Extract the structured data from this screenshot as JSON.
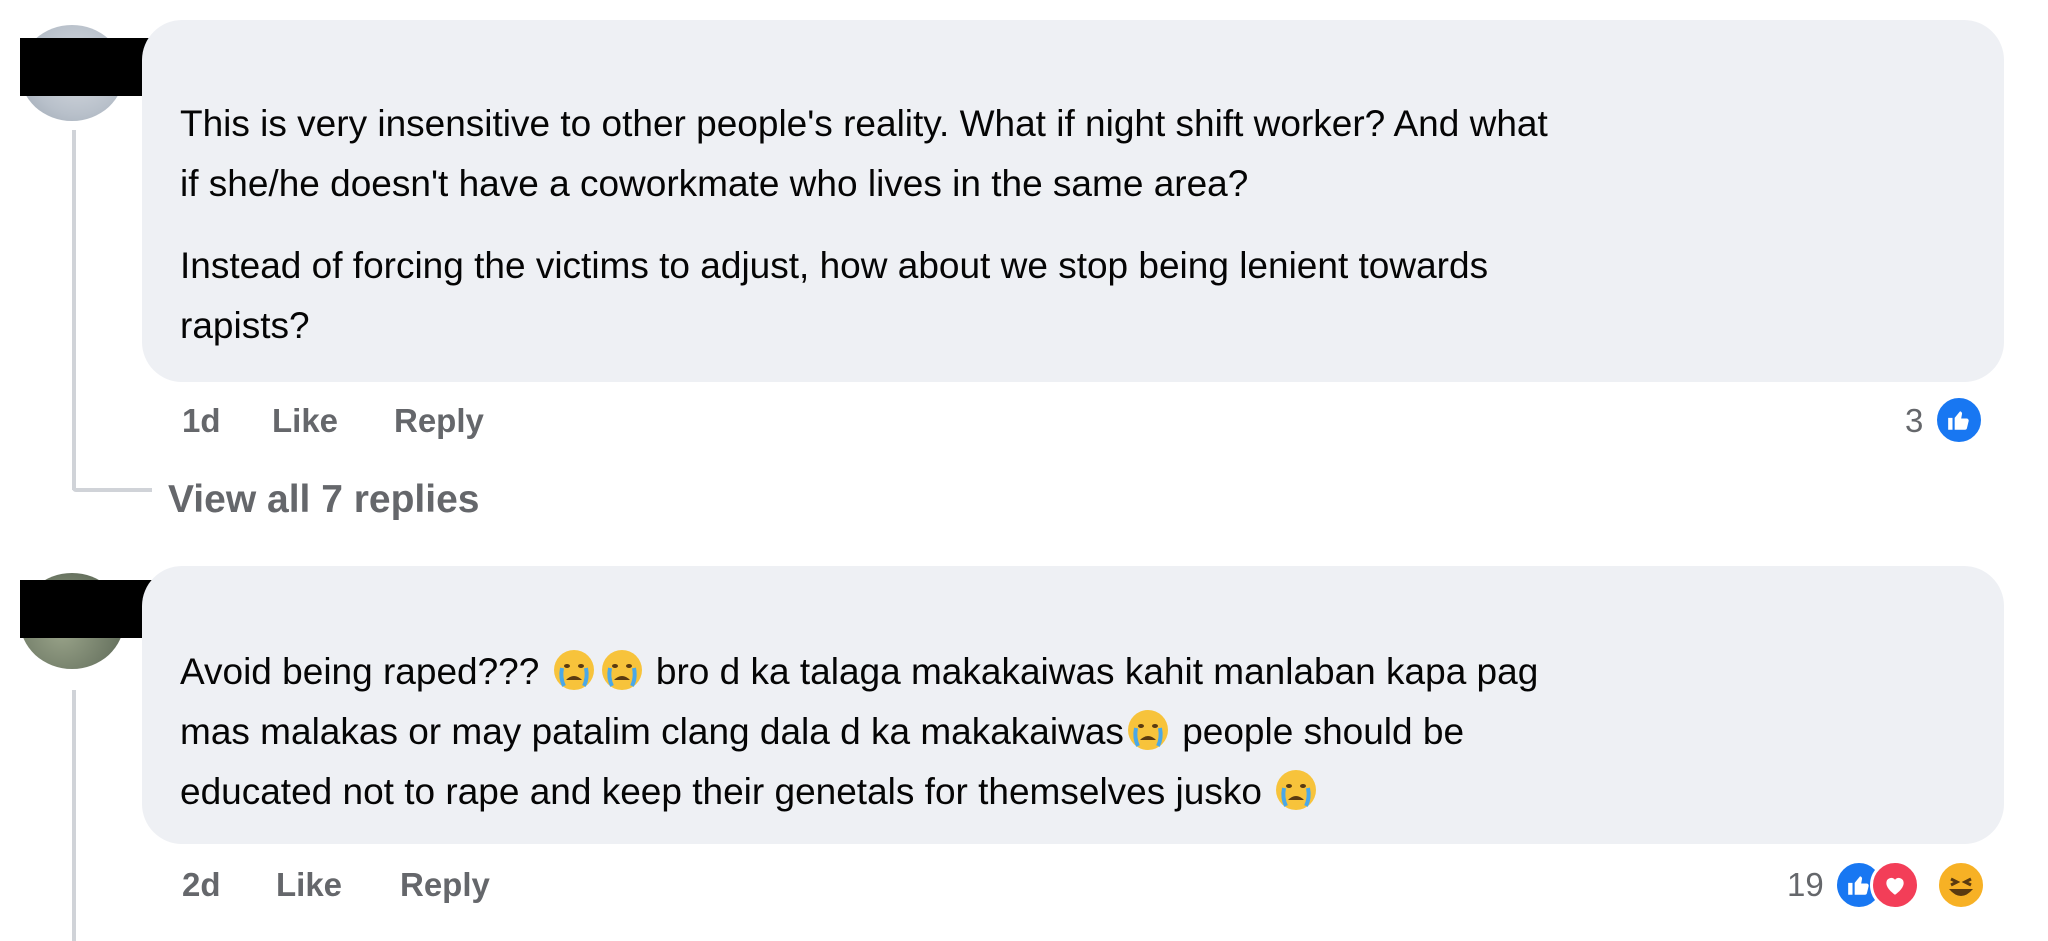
{
  "comments": [
    {
      "paragraphs": [
        "This is very insensitive to other people's reality. What if night shift worker? And what",
        "if she/he doesn't have a coworkmate who lives in the same area?",
        "Instead of forcing the victims to adjust, how about we stop being lenient towards",
        "rapists?"
      ],
      "time": "1d",
      "like_label": "Like",
      "reply_label": "Reply",
      "reaction_count": "3",
      "reactions": [
        "like-icon"
      ],
      "view_replies": "View all 7 replies"
    },
    {
      "line1_a": "Avoid being raped???",
      "line1_b": "bro d ka talaga makakaiwas kahit manlaban kapa pag",
      "line2_a": "mas malakas or may patalim clang dala d ka makakaiwas",
      "line2_b": "people should be",
      "line3_a": "educated not to rape and keep their genetals for themselves jusko",
      "emoji": "crying-face-emoji",
      "time": "2d",
      "like_label": "Like",
      "reply_label": "Reply",
      "reaction_count": "19",
      "reactions": [
        "like-icon",
        "love-icon",
        "haha-icon"
      ]
    }
  ]
}
